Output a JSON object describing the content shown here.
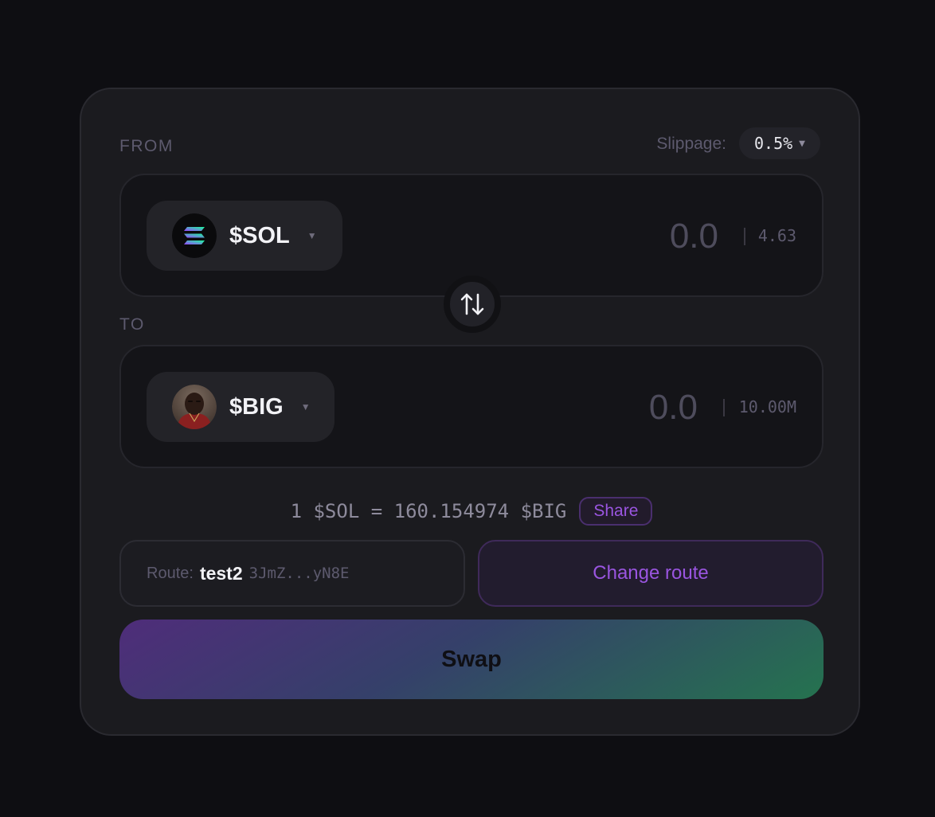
{
  "from": {
    "label": "FROM",
    "token_symbol": "$SOL",
    "amount": "0.0",
    "balance": "4.63",
    "icon": "solana-logo-icon"
  },
  "to": {
    "label": "TO",
    "token_symbol": "$BIG",
    "amount": "0.0",
    "balance": "10.00M",
    "icon": "token-avatar"
  },
  "slippage": {
    "label": "Slippage:",
    "value": "0.5%"
  },
  "rate": {
    "text": "1 $SOL = 160.154974 $BIG",
    "share_label": "Share"
  },
  "route": {
    "label": "Route:",
    "name": "test2",
    "address": "3JmZ...yN8E",
    "change_label": "Change route"
  },
  "swap": {
    "label": "Swap"
  },
  "colors": {
    "background": "#0e0e12",
    "card": "#1b1b1f",
    "accent_purple": "#9a55e0",
    "gradient_start": "#4f2d7a",
    "gradient_end": "#25734f"
  }
}
